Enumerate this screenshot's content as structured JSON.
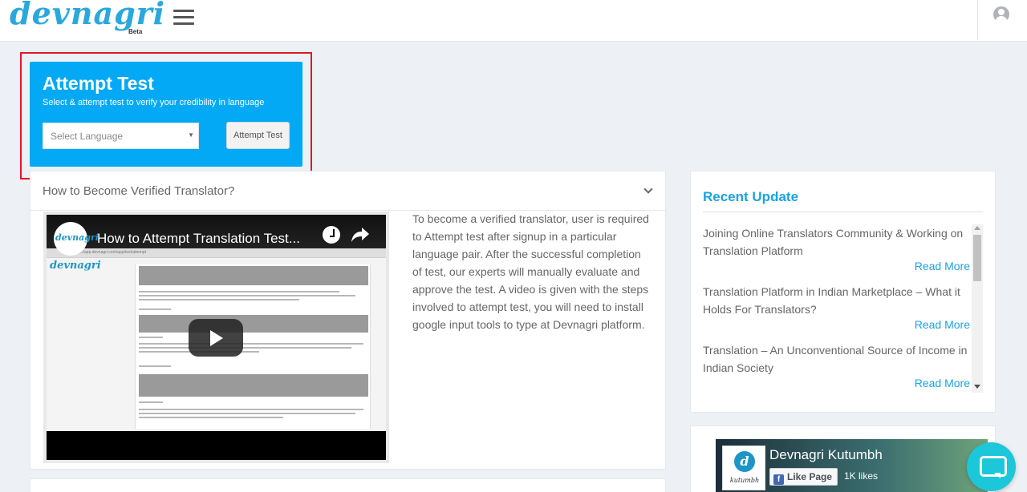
{
  "header": {
    "logo": "devnagri",
    "logo_badge": "Beta"
  },
  "attempt": {
    "title": "Attempt Test",
    "subtitle": "Select & attempt test to verify your credibility in language",
    "language_placeholder": "Select Language",
    "button": "Attempt Test"
  },
  "accordion": {
    "title": "How to Become Verified Translator?",
    "video_title": "How to Attempt Translation Test...",
    "video_channel_logo": "devnagri",
    "video_url_text": "https://app.devnagri.com/app/test/attempt",
    "description": "To become a verified translator, user is required to Attempt test after signup in a particular language pair. After the successful completion of test, our experts will manually evaluate and approve the test. A video is given with the steps involved to attempt test, you will need to install google input tools to type at Devnagri platform."
  },
  "recent": {
    "title": "Recent Update",
    "items": [
      {
        "title": "Joining Online Translators Community & Working on Translation Platform",
        "more": "Read More"
      },
      {
        "title": "Translation Platform in Indian Marketplace – What it Holds For Translators?",
        "more": "Read More"
      },
      {
        "title": "Translation – An Unconventional Source of Income in Indian Society",
        "more": "Read More"
      }
    ]
  },
  "facebook": {
    "page_name": "Devnagri Kutumbh",
    "logo_text": "kutumbh",
    "like_label": "Like Page",
    "likes": "1K likes"
  },
  "colors": {
    "accent": "#03a9f4",
    "link": "#1ea1e3",
    "highlight_border": "#e0191e",
    "chat": "#1cc7d9"
  }
}
